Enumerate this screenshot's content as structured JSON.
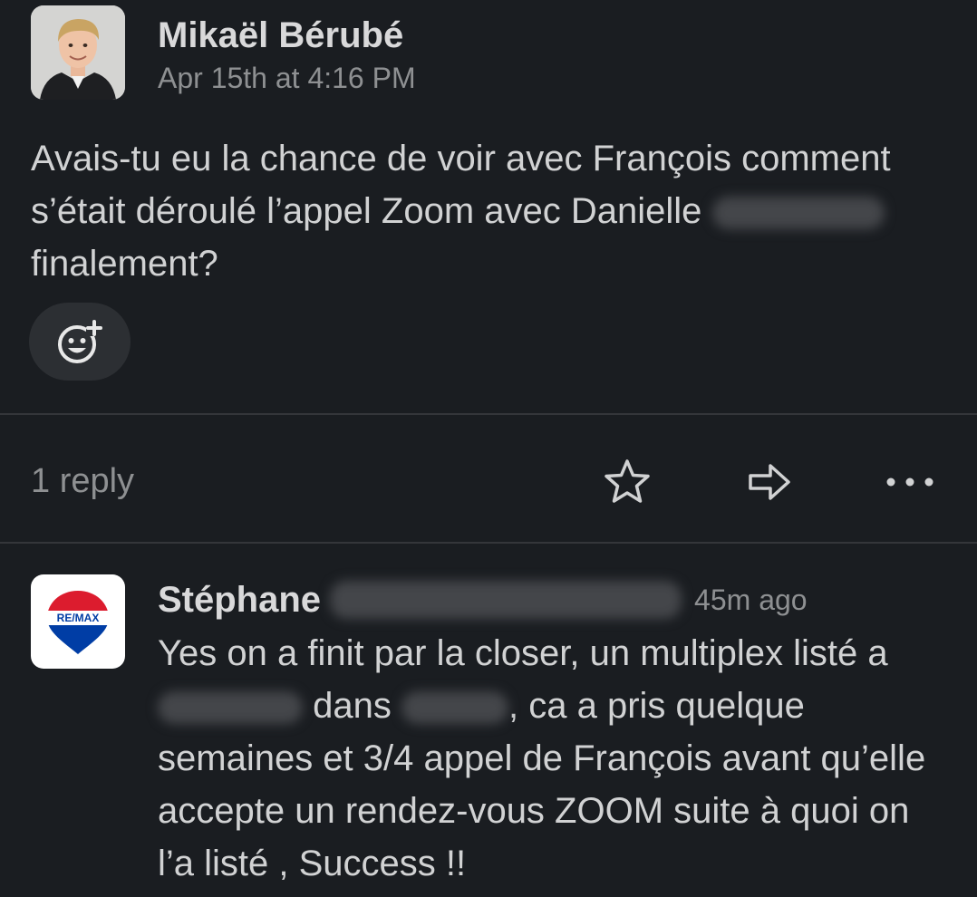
{
  "message": {
    "author": "Mikaël Bérubé",
    "timestamp": "Apr 15th at 4:16 PM",
    "text_part1": "Avais-tu eu la chance de voir avec François comment s’était déroulé l’appel Zoom avec Danielle",
    "text_part2": "finalement?"
  },
  "actions": {
    "reply_count": "1 reply",
    "icons": [
      "add-reaction-icon",
      "star-icon",
      "share-arrow-icon",
      "more-dots-icon"
    ]
  },
  "reply": {
    "author": "Stéphane",
    "timestamp": "45m ago",
    "avatar_brand_text": "RE/MAX",
    "text_part1": "Yes on a finit par la closer, un multiplex listé a",
    "text_part2": "dans",
    "text_part3": ", ca a pris quelque semaines et 3/4 appel de François avant qu’elle accepte un rendez-vous ZOOM suite à quoi on l’a listé , Success !!"
  },
  "colors": {
    "background": "#1a1d21",
    "text": "#d1d2d3",
    "muted": "#8e9092",
    "divider": "#34363a",
    "brand_red": "#dc1c2e",
    "brand_blue": "#003da5"
  }
}
